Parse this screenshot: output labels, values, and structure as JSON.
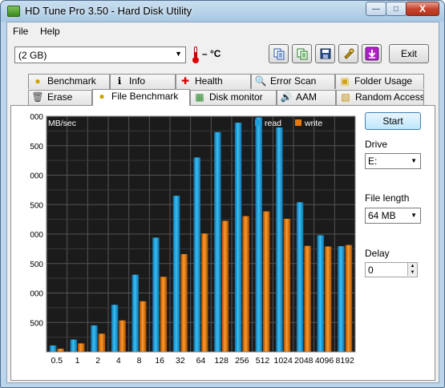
{
  "window": {
    "title": "HD Tune Pro 3.50 - Hard Disk Utility",
    "buttons": {
      "minimize": "—",
      "maximize": "□",
      "close": "X"
    }
  },
  "menu": {
    "file": "File",
    "help": "Help"
  },
  "toolbar": {
    "disk": "(2 GB)",
    "temperature": "– °C",
    "exit_label": "Exit",
    "icons": [
      "copy-text-icon",
      "copy-info-icon",
      "save-icon",
      "options-icon",
      "down-arrow-icon"
    ]
  },
  "tabs": {
    "row1": [
      {
        "label": "Benchmark",
        "icon": "benchmark-icon"
      },
      {
        "label": "Info",
        "icon": "info-icon"
      },
      {
        "label": "Health",
        "icon": "health-icon"
      },
      {
        "label": "Error Scan",
        "icon": "error-scan-icon"
      },
      {
        "label": "Folder Usage",
        "icon": "folder-usage-icon"
      }
    ],
    "row2": [
      {
        "label": "Erase",
        "icon": "erase-icon"
      },
      {
        "label": "File Benchmark",
        "icon": "file-benchmark-icon",
        "active": true
      },
      {
        "label": "Disk monitor",
        "icon": "disk-monitor-icon"
      },
      {
        "label": "AAM",
        "icon": "aam-icon"
      },
      {
        "label": "Random Access",
        "icon": "random-access-icon"
      }
    ]
  },
  "controls": {
    "start_label": "Start",
    "drive_label": "Drive",
    "drive_value": "E:",
    "file_length_label": "File length",
    "file_length_value": "64 MB",
    "delay_label": "Delay",
    "delay_value": "0"
  },
  "chart_data": {
    "type": "bar",
    "ylabel": "MB/sec",
    "ylim": [
      0,
      8000
    ],
    "yticks": [
      {
        "value": 1000,
        "label": "500"
      },
      {
        "value": 2000,
        "label": "000"
      },
      {
        "value": 3000,
        "label": "500"
      },
      {
        "value": 4000,
        "label": "000"
      },
      {
        "value": 5000,
        "label": "500"
      },
      {
        "value": 6000,
        "label": "000"
      },
      {
        "value": 7000,
        "label": "500"
      },
      {
        "value": 8000,
        "label": "000"
      }
    ],
    "categories": [
      "0.5",
      "1",
      "2",
      "4",
      "8",
      "16",
      "32",
      "64",
      "128",
      "256",
      "512",
      "1024",
      "2048",
      "4096",
      "8192"
    ],
    "series": [
      {
        "name": "read",
        "color": "#1e9fd9",
        "values": [
          220,
          420,
          900,
          1600,
          2620,
          3880,
          5300,
          6600,
          7460,
          7780,
          7960,
          7620,
          5080,
          3960,
          3590
        ]
      },
      {
        "name": "write",
        "color": "#e8780e",
        "values": [
          110,
          290,
          620,
          1070,
          1720,
          2550,
          3320,
          4020,
          4450,
          4610,
          4770,
          4520,
          3600,
          3580,
          3630
        ]
      }
    ],
    "legend": "top-right",
    "background": "#1b1b1b",
    "grid": true
  }
}
